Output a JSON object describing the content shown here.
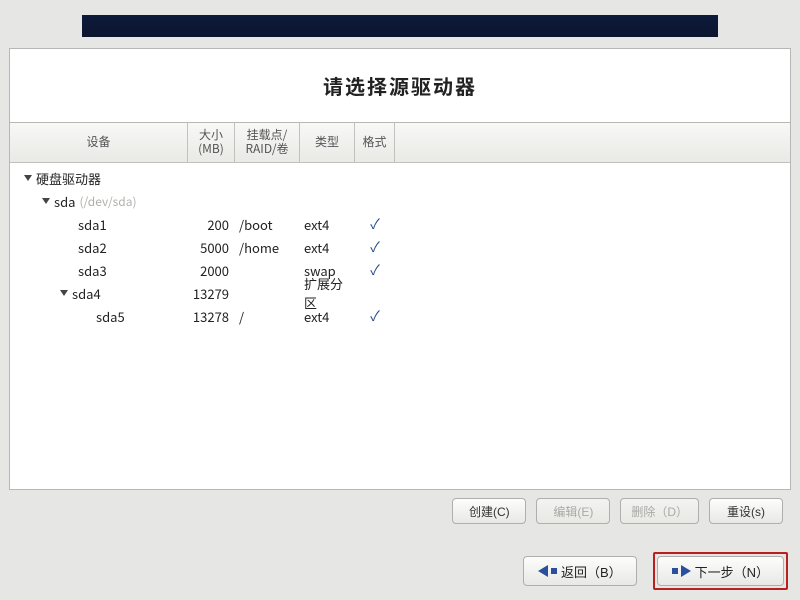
{
  "title": "请选择源驱动器",
  "columns": {
    "device": "设备",
    "size": "大小\n(MB)",
    "mountpoint": "挂载点/\nRAID/卷",
    "type": "类型",
    "format": "格式"
  },
  "tree": {
    "root_label": "硬盘驱动器",
    "disk": {
      "name": "sda",
      "hint": "(/dev/sda)"
    },
    "partitions": [
      {
        "name": "sda1",
        "size": "200",
        "mp": "/boot",
        "type": "ext4",
        "fmt": true,
        "indent": 68,
        "expander": false
      },
      {
        "name": "sda2",
        "size": "5000",
        "mp": "/home",
        "type": "ext4",
        "fmt": true,
        "indent": 68,
        "expander": false
      },
      {
        "name": "sda3",
        "size": "2000",
        "mp": "",
        "type": "swap",
        "fmt": true,
        "indent": 68,
        "expander": false
      },
      {
        "name": "sda4",
        "size": "13279",
        "mp": "",
        "type": "扩展分区",
        "fmt": false,
        "indent": 50,
        "expander": true
      },
      {
        "name": "sda5",
        "size": "13278",
        "mp": "/",
        "type": "ext4",
        "fmt": true,
        "indent": 86,
        "expander": false
      }
    ]
  },
  "buttons": {
    "create": "创建(C)",
    "edit": "编辑(E)",
    "delete": "删除（D）",
    "reset": "重设(s)",
    "back": "返回（B）",
    "next": "下一步（N）"
  }
}
